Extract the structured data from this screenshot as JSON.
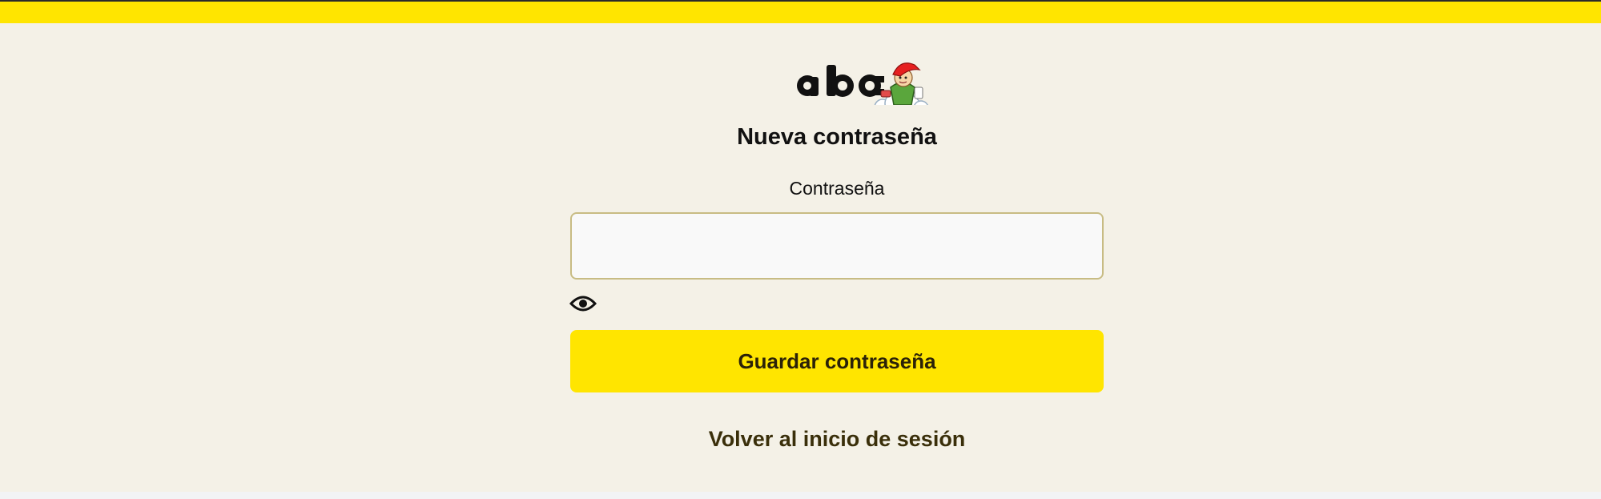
{
  "brand": {
    "accent_color": "#ffe500",
    "background_color": "#f4f1e7",
    "logo_text": "abc"
  },
  "form": {
    "title": "Nueva contraseña",
    "password_label": "Contraseña",
    "password_value": "",
    "password_placeholder": "",
    "toggle_icon": "eye-icon",
    "save_label": "Guardar contraseña",
    "back_link_label": "Volver al inicio de sesión"
  }
}
